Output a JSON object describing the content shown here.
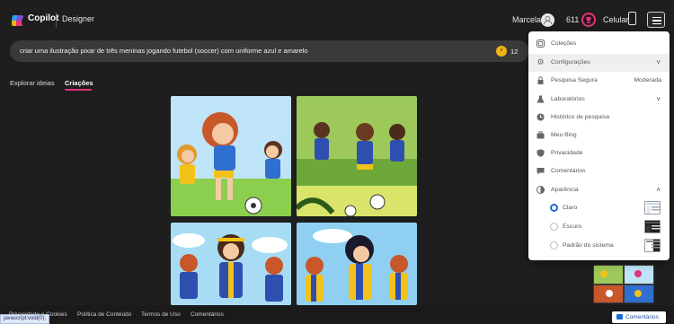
{
  "header": {
    "brand": "Copilot",
    "product": "Designer",
    "user_name": "Marcela",
    "rewards_count": "611",
    "mobile_label": "Celular"
  },
  "prompt": {
    "text": "criar uma ilustração pixar de três meninas jogando futebol (soccer) com uniforme azul e amarelo",
    "boosts": "12"
  },
  "tabs": [
    {
      "label": "Explorar ideias",
      "active": false
    },
    {
      "label": "Criações",
      "active": true
    }
  ],
  "menu": {
    "items": [
      {
        "label": "Coleções",
        "icon": "collections-icon"
      },
      {
        "label": "Configurações",
        "icon": "gear-icon",
        "chevron": "˅"
      },
      {
        "label": "Pesquisa Segura",
        "icon": "lock-icon",
        "value": "Moderada"
      },
      {
        "label": "Laboratórios",
        "icon": "flask-icon",
        "chevron": "˅"
      },
      {
        "label": "Histórico de pesquisa",
        "icon": "history-icon"
      },
      {
        "label": "Meu Bing",
        "icon": "briefcase-icon"
      },
      {
        "label": "Privacidade",
        "icon": "shield-icon"
      },
      {
        "label": "Comentários",
        "icon": "comment-icon"
      },
      {
        "label": "Aparência",
        "icon": "theme-icon",
        "chevron": "˄"
      }
    ],
    "appearance_options": [
      {
        "label": "Claro",
        "checked": true
      },
      {
        "label": "Escuro",
        "checked": false
      },
      {
        "label": "Padrão do sistema",
        "checked": false
      }
    ]
  },
  "footer": {
    "links": [
      "Privacidade e Cookies",
      "Política de Conteúdo",
      "Termos de Uso",
      "Comentários"
    ],
    "status_url": "javascript:void(0);",
    "feedback_label": "Comentários"
  },
  "colors": {
    "background": "#1e1e1e",
    "accent": "#e0337a",
    "link_blue": "#1f6bd4"
  }
}
